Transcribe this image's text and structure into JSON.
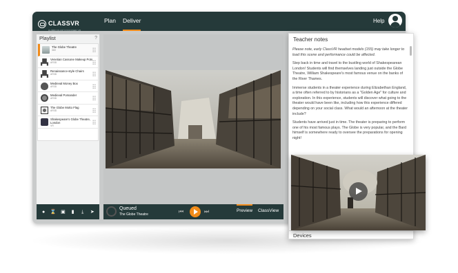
{
  "app": {
    "logo_text": "CLASSVR",
    "logo_subtitle": "CURRICULUM FOCUSSED VR",
    "nav": [
      {
        "label": "Plan",
        "active": false
      },
      {
        "label": "Deliver",
        "active": true
      }
    ],
    "help_label": "Help",
    "accent_color": "#f28c1a",
    "bar_color": "#253a3a"
  },
  "playlist": {
    "title": "Playlist",
    "help_icon": "?",
    "items": [
      {
        "title": "The Globe Theatre",
        "meta": "360",
        "icon": "theatre-thumbnail",
        "selected": true
      },
      {
        "title": "Venetian Cassone Makeup Pots",
        "meta": "AR3D",
        "icon": "chair-thumbnail",
        "selected": false
      },
      {
        "title": "Renaissance-style Chairs",
        "meta": "AR3D",
        "icon": "chair-thumbnail",
        "selected": false
      },
      {
        "title": "Medieval Money Box",
        "meta": "AR3D",
        "icon": "pot-thumbnail",
        "selected": false
      },
      {
        "title": "Medieval Pomander",
        "meta": "AR3D",
        "icon": "pomander-thumbnail",
        "selected": false
      },
      {
        "title": "The Globe Motto Flag",
        "meta": "AR3D",
        "icon": "flag-thumbnail",
        "selected": false
      },
      {
        "title": "Shakespeare's Globe Theatre, London",
        "meta": "VR",
        "icon": "globe-thumbnail",
        "selected": false
      }
    ],
    "toolbar_icons": [
      "user-icon",
      "hourglass-icon",
      "save-icon",
      "trash-icon",
      "download-icon",
      "send-icon"
    ]
  },
  "player": {
    "status": "Queued",
    "now_playing": "The Globe Theatre",
    "tabs": [
      {
        "label": "Preview",
        "active": true
      },
      {
        "label": "ClassView",
        "active": false
      }
    ]
  },
  "notes": {
    "title": "Teacher notes",
    "warning": "Please note, early ClassVR headset models (155) may take longer to load this scene and performance could be affected.",
    "paragraphs": [
      "Step back in time and travel to the bustling world of Shakespearean London! Students will find themselves landing just outside the Globe Theatre, William Shakespeare's most famous venue on the banks of the River Thames.",
      "Immerse students in a theater experience during Elizabethan England, a time often referred to by historians as a \"Golden Age\" for culture and exploration. In this experience, students will discover what going to the theater would have been like, including how this experience differed depending on your social class. What would an afternoon at the theater include?",
      "Students have arrived just in time. The theater is preparing to perform one of his most famous plays. The Globe is very popular, and the Bard himself is somewhere ready to oversee the preparations for opening night!"
    ],
    "devices_label": "Devices"
  }
}
